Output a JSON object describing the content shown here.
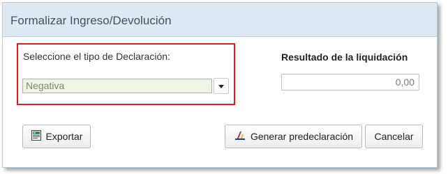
{
  "dialog": {
    "title": "Formalizar Ingreso/Devolución"
  },
  "declaration": {
    "label": "Seleccione el tipo de Declaración:",
    "selected": "Negativa"
  },
  "result": {
    "label": "Resultado de la liquidación",
    "value": "0,00"
  },
  "buttons": {
    "export_label": "Exportar",
    "export_icon": "export-document-icon",
    "generate_label": "Generar predeclaración",
    "generate_icon": "tax-agency-icon",
    "cancel_label": "Cancelar"
  },
  "colors": {
    "title_bar": "#dee8f3",
    "highlight": "#e21d1d",
    "select_bg": "#eef5e4"
  }
}
